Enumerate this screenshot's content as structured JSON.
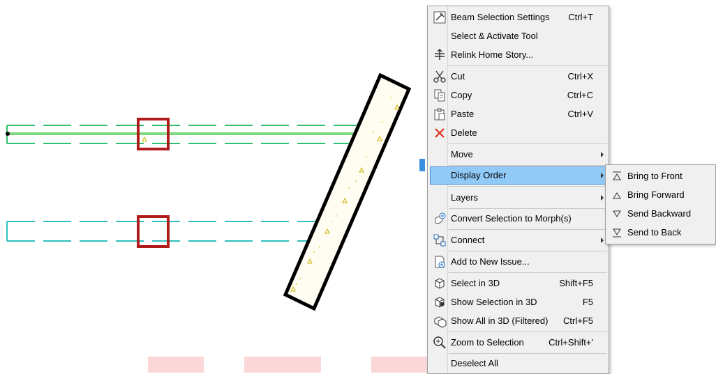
{
  "context_menu": {
    "items": [
      {
        "label": "Beam Selection Settings",
        "shortcut": "Ctrl+T",
        "icon": "beam-settings-icon"
      },
      {
        "label": "Select & Activate Tool",
        "shortcut": "",
        "icon": ""
      },
      {
        "label": "Relink Home Story...",
        "shortcut": "",
        "icon": "relink-story-icon"
      },
      {
        "label": "Cut",
        "shortcut": "Ctrl+X",
        "icon": "scissors-icon"
      },
      {
        "label": "Copy",
        "shortcut": "Ctrl+C",
        "icon": "copy-icon"
      },
      {
        "label": "Paste",
        "shortcut": "Ctrl+V",
        "icon": "paste-icon"
      },
      {
        "label": "Delete",
        "shortcut": "",
        "icon": "delete-x-icon"
      },
      {
        "label": "Move",
        "shortcut": "",
        "icon": ""
      },
      {
        "label": "Display Order",
        "shortcut": "",
        "icon": ""
      },
      {
        "label": "Layers",
        "shortcut": "",
        "icon": ""
      },
      {
        "label": "Convert Selection to Morph(s)",
        "shortcut": "",
        "icon": "morph-icon"
      },
      {
        "label": "Connect",
        "shortcut": "",
        "icon": "connect-icon"
      },
      {
        "label": "Add to New Issue...",
        "shortcut": "",
        "icon": "new-issue-icon"
      },
      {
        "label": "Select in 3D",
        "shortcut": "Shift+F5",
        "icon": "cube-select-icon"
      },
      {
        "label": "Show Selection in 3D",
        "shortcut": "F5",
        "icon": "cube-show-icon"
      },
      {
        "label": "Show All in 3D (Filtered)",
        "shortcut": "Ctrl+F5",
        "icon": "cube-all-icon"
      },
      {
        "label": "Zoom to Selection",
        "shortcut": "Ctrl+Shift+'",
        "icon": "zoom-selection-icon"
      },
      {
        "label": "Deselect All",
        "shortcut": "",
        "icon": ""
      }
    ]
  },
  "submenu": {
    "items": [
      {
        "label": "Bring to Front",
        "icon": "bring-to-front-icon"
      },
      {
        "label": "Bring Forward",
        "icon": "bring-forward-icon"
      },
      {
        "label": "Send Backward",
        "icon": "send-backward-icon"
      },
      {
        "label": "Send to Back",
        "icon": "send-to-back-icon"
      }
    ]
  },
  "colors": {
    "menu_bg": "#f0f0f0",
    "highlight": "#91c9f7",
    "beam_green": "#2fbf6f",
    "beam_cyan": "#2ebfbf",
    "selection_line": "#7fd97f",
    "column_red": "#b01c1c",
    "delete_red": "#e0301e"
  }
}
